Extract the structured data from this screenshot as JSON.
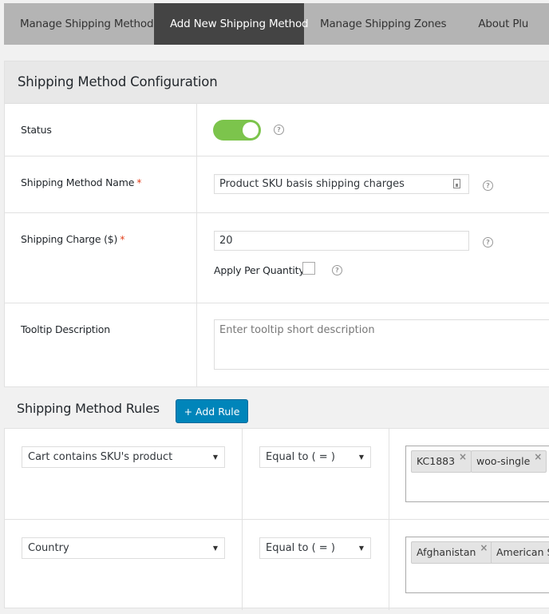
{
  "tabs": [
    {
      "label": "Manage Shipping Methods",
      "active": false
    },
    {
      "label": "Add New Shipping Method",
      "active": true
    },
    {
      "label": "Manage Shipping Zones",
      "active": false
    },
    {
      "label": "About Plu",
      "active": false
    }
  ],
  "config": {
    "title": "Shipping Method Configuration",
    "status": {
      "label": "Status",
      "enabled": true
    },
    "name": {
      "label": "Shipping Method Name",
      "required_mark": "*",
      "value": "Product SKU basis shipping charges"
    },
    "charge": {
      "label": "Shipping Charge ($)",
      "required_mark": "*",
      "value": "20",
      "per_quantity_label": "Apply Per Quantity",
      "per_quantity_checked": false
    },
    "tooltip": {
      "label": "Tooltip Description",
      "placeholder": "Enter tooltip short description"
    },
    "help_glyph": "?"
  },
  "rules": {
    "title": "Shipping Method Rules",
    "add_button": "+ Add Rule",
    "rows": [
      {
        "condition": "Cart contains SKU's product",
        "operator": "Equal to ( = )",
        "values": [
          "KC1883",
          "woo-single"
        ]
      },
      {
        "condition": "Country",
        "operator": "Equal to ( = )",
        "values": [
          "Afghanistan",
          "American Samoa"
        ]
      }
    ],
    "remove_glyph": "×",
    "dropdown_glyph": "▼"
  },
  "colors": {
    "toggle_on": "#7cc44c",
    "button_primary": "#0085ba",
    "active_tab": "#444444"
  }
}
